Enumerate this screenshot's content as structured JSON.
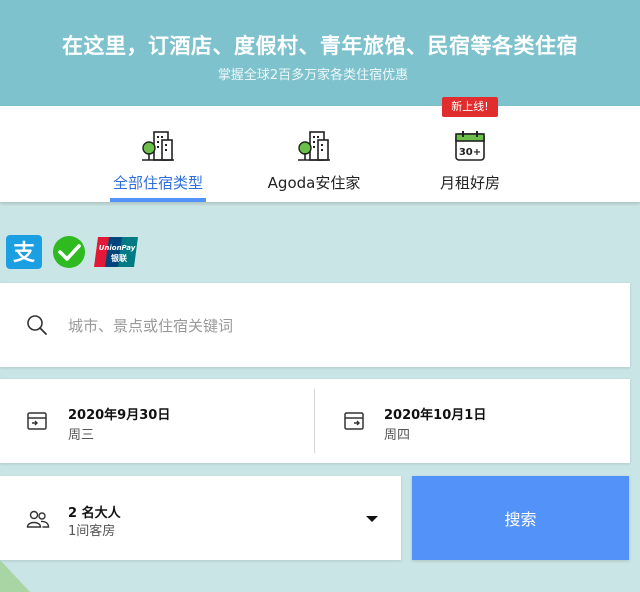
{
  "header": {
    "title": "在这里，订酒店、度假村、青年旅馆、民宿等各类住宿",
    "subtitle": "掌握全球2百多万家各类住宿优惠"
  },
  "tabs": [
    {
      "label": "全部住宿类型",
      "icon": "building-tree-icon",
      "active": true
    },
    {
      "label": "Agoda安住家",
      "icon": "building-tree-icon",
      "active": false
    },
    {
      "label": "月租好房",
      "icon": "calendar-30-icon",
      "active": false,
      "badge": "新上线!"
    }
  ],
  "payments": [
    "alipay-icon",
    "wechat-pay-icon",
    "unionpay-icon"
  ],
  "search": {
    "placeholder": "城市、景点或住宿关键词",
    "value": ""
  },
  "checkin": {
    "date": "2020年9月30日",
    "weekday": "周三"
  },
  "checkout": {
    "date": "2020年10月1日",
    "weekday": "周四"
  },
  "guests": {
    "adults": "2 名大人",
    "rooms": "1间客房"
  },
  "search_button": {
    "label": "搜索"
  },
  "colors": {
    "header_bg": "#7dc2cc",
    "accent": "#5392f9",
    "badge": "#e12d2d",
    "page_bg": "#c9e5e5"
  }
}
